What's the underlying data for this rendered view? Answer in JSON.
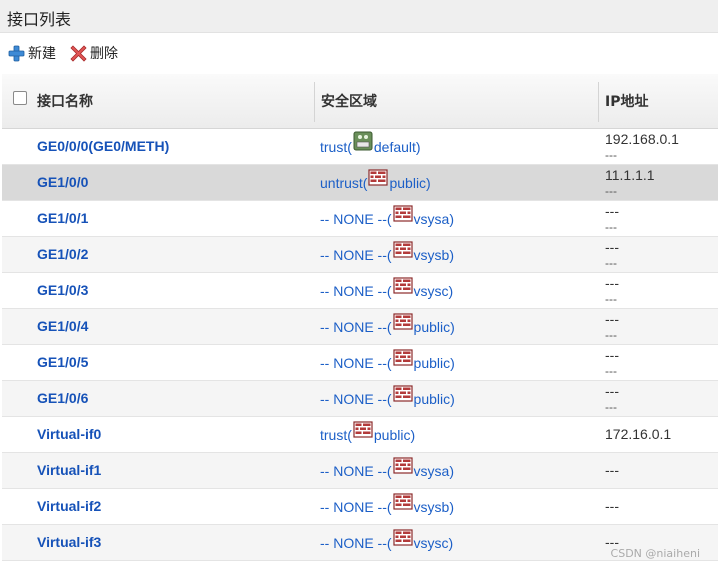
{
  "page": {
    "title": "接口列表"
  },
  "toolbar": {
    "new_label": "新建",
    "delete_label": "删除"
  },
  "table": {
    "columns": {
      "name": "接口名称",
      "zone": "安全区域",
      "ip": "IP地址"
    },
    "rows": [
      {
        "name": "GE0/0/0(GE0/METH)",
        "zone": "trust(",
        "vsys": "default)",
        "ip1": "192.168.0.1",
        "ip2": "---",
        "icon": "green-vsys-icon"
      },
      {
        "name": "GE1/0/0",
        "zone": "untrust(",
        "vsys": "public)",
        "ip1": "11.1.1.1",
        "ip2": "---",
        "icon": "firewall-icon"
      },
      {
        "name": "GE1/0/1",
        "zone": "-- NONE --(",
        "vsys": "vsysa)",
        "ip1": "---",
        "ip2": "---",
        "icon": "firewall-icon"
      },
      {
        "name": "GE1/0/2",
        "zone": "-- NONE --(",
        "vsys": "vsysb)",
        "ip1": "---",
        "ip2": "---",
        "icon": "firewall-icon"
      },
      {
        "name": "GE1/0/3",
        "zone": "-- NONE --(",
        "vsys": "vsysc)",
        "ip1": "---",
        "ip2": "---",
        "icon": "firewall-icon"
      },
      {
        "name": "GE1/0/4",
        "zone": "-- NONE --(",
        "vsys": "public)",
        "ip1": "---",
        "ip2": "---",
        "icon": "firewall-icon"
      },
      {
        "name": "GE1/0/5",
        "zone": "-- NONE --(",
        "vsys": "public)",
        "ip1": "---",
        "ip2": "---",
        "icon": "firewall-icon"
      },
      {
        "name": "GE1/0/6",
        "zone": "-- NONE --(",
        "vsys": "public)",
        "ip1": "---",
        "ip2": "---",
        "icon": "firewall-icon"
      },
      {
        "name": "Virtual-if0",
        "zone": "trust(",
        "vsys": "public)",
        "ip1": "172.16.0.1",
        "ip2": "",
        "icon": "firewall-icon"
      },
      {
        "name": "Virtual-if1",
        "zone": "-- NONE --(",
        "vsys": "vsysa)",
        "ip1": "---",
        "ip2": "",
        "icon": "firewall-icon"
      },
      {
        "name": "Virtual-if2",
        "zone": "-- NONE --(",
        "vsys": "vsysb)",
        "ip1": "---",
        "ip2": "",
        "icon": "firewall-icon"
      },
      {
        "name": "Virtual-if3",
        "zone": "-- NONE --(",
        "vsys": "vsysc)",
        "ip1": "---",
        "ip2": "",
        "icon": "firewall-icon"
      }
    ]
  },
  "watermark": "CSDN @niaiheni",
  "colors": {
    "link": "#1c5fc7",
    "name": "#1652b8",
    "selected_row": "#d9d9d9"
  }
}
